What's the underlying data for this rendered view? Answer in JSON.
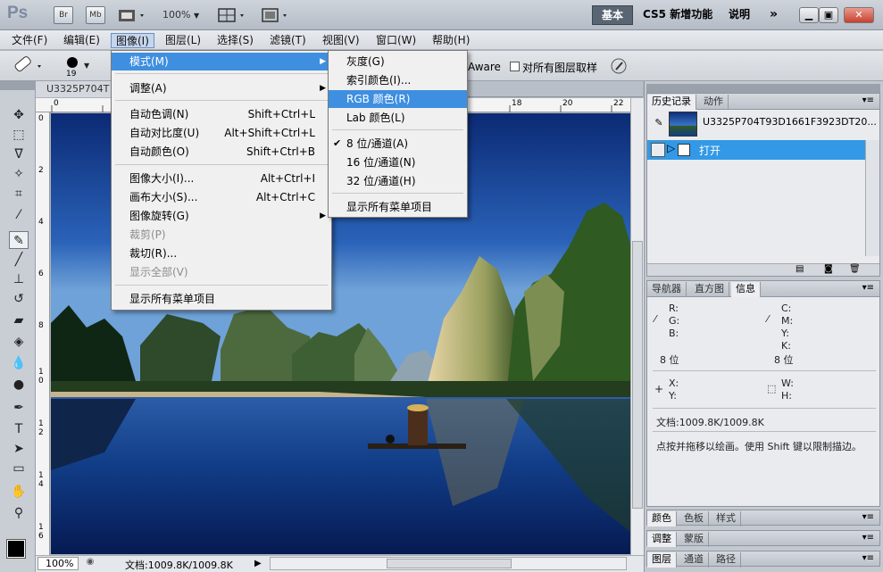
{
  "appbar": {
    "logo": "Ps",
    "br": "Br",
    "mb": "Mb",
    "zoom": "100%",
    "workspaces": [
      "基本",
      "CS5 新增功能",
      "说明"
    ],
    "more": "»"
  },
  "menubar": {
    "items": [
      "文件(F)",
      "编辑(E)",
      "图像(I)",
      "图层(L)",
      "选择(S)",
      "滤镜(T)",
      "视图(V)",
      "窗口(W)",
      "帮助(H)"
    ]
  },
  "options": {
    "brush_size": "19",
    "aware": "Aware",
    "sample_all": "对所有图层取样"
  },
  "document": {
    "tab_title": "U3325P704T",
    "status_zoom": "100%",
    "status_doc": "文档:1009.8K/1009.8K",
    "ruler_h": [
      "0",
      "2",
      "4",
      "6",
      "8",
      "10",
      "12",
      "14",
      "16",
      "18",
      "20",
      "22"
    ],
    "ruler_v": [
      "0",
      "2",
      "4",
      "6",
      "8",
      "1",
      "0",
      "1",
      "2",
      "1",
      "4",
      "1",
      "6"
    ]
  },
  "image_menu": {
    "items": [
      {
        "label": "模式(M)",
        "shortcut": "",
        "submenu": true,
        "highlight": true
      },
      {
        "label": "调整(A)",
        "shortcut": "",
        "submenu": true
      },
      {
        "label": "自动色调(N)",
        "shortcut": "Shift+Ctrl+L"
      },
      {
        "label": "自动对比度(U)",
        "shortcut": "Alt+Shift+Ctrl+L"
      },
      {
        "label": "自动颜色(O)",
        "shortcut": "Shift+Ctrl+B"
      },
      {
        "label": "图像大小(I)...",
        "shortcut": "Alt+Ctrl+I"
      },
      {
        "label": "画布大小(S)...",
        "shortcut": "Alt+Ctrl+C"
      },
      {
        "label": "图像旋转(G)",
        "shortcut": "",
        "submenu": true
      },
      {
        "label": "裁剪(P)",
        "shortcut": "",
        "disabled": true
      },
      {
        "label": "裁切(R)...",
        "shortcut": ""
      },
      {
        "label": "显示全部(V)",
        "shortcut": "",
        "disabled": true
      },
      {
        "label": "显示所有菜单项目",
        "shortcut": ""
      }
    ]
  },
  "mode_submenu": {
    "items": [
      {
        "label": "灰度(G)"
      },
      {
        "label": "索引颜色(I)..."
      },
      {
        "label": "RGB 颜色(R)",
        "highlight": true
      },
      {
        "label": "Lab 颜色(L)"
      },
      {
        "label": "8 位/通道(A)",
        "checked": true
      },
      {
        "label": "16 位/通道(N)"
      },
      {
        "label": "32 位/通道(H)"
      },
      {
        "label": "显示所有菜单项目"
      }
    ]
  },
  "history_panel": {
    "tabs": [
      "历史记录",
      "动作"
    ],
    "snapshot": "U3325P704T93D1661F3923DT20...",
    "step": "打开"
  },
  "info_panel": {
    "tabs": [
      "导航器",
      "直方图",
      "信息"
    ],
    "r": "R:",
    "g": "G:",
    "b": "B:",
    "c": "C:",
    "m": "M:",
    "y": "Y:",
    "k": "K:",
    "bits_left": "8 位",
    "bits_right": "8 位",
    "x": "X:",
    "y2": "Y:",
    "w": "W:",
    "h": "H:",
    "doc": "文档:1009.8K/1009.8K",
    "hint": "点按并拖移以绘画。使用 Shift 键以限制描边。"
  },
  "bottom_panels": [
    [
      "颜色",
      "色板",
      "样式"
    ],
    [
      "调整",
      "蒙版"
    ],
    [
      "图层",
      "通道",
      "路径"
    ]
  ],
  "colors": {
    "highlight": "#3f8fe0",
    "history_step": "#3399e6"
  }
}
